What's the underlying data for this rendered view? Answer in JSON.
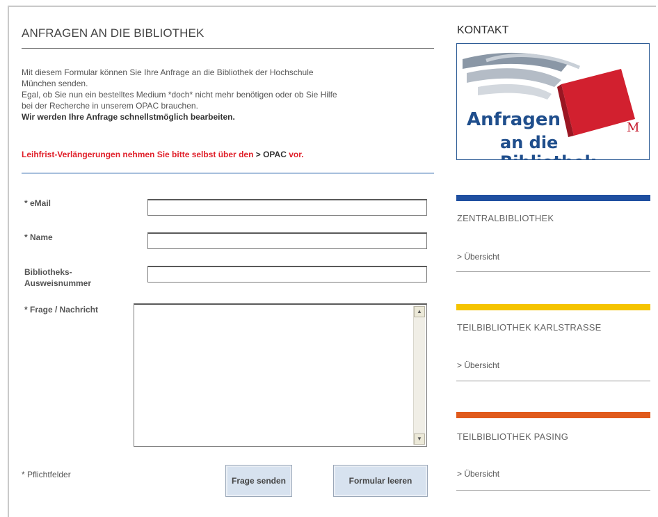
{
  "page": {
    "title": "ANFRAGEN AN DIE BIBLIOTHEK"
  },
  "intro": {
    "line1": "Mit diesem Formular können Sie Ihre Anfrage an die Bibliothek der Hochschule",
    "line2": "München senden.",
    "line3": "Egal, ob Sie nun ein bestelltes Medium *doch* nicht mehr benötigen oder ob Sie Hilfe",
    "line4": "bei der Recherche in unserem OPAC brauchen.",
    "bold": "Wir werden Ihre Anfrage schnellstmöglich bearbeiten."
  },
  "notice": {
    "text": "Leihfrist-Verlängerungen nehmen Sie bitte selbst über den",
    "link": "> OPAC",
    "suffix": "vor."
  },
  "form": {
    "email_label": "* eMail",
    "email_value": "",
    "name_label": "* Name",
    "name_value": "",
    "card_label_1": "Bibliotheks-",
    "card_label_2": "Ausweisnummer",
    "card_value": "",
    "message_label": "* Frage / Nachricht",
    "message_value": "",
    "required_note": "* Pflichtfelder",
    "submit_label": "Frage senden",
    "reset_label": "Formular leeren"
  },
  "sidebar": {
    "kontakt_heading": "KONTAKT",
    "logo_line1": "Anfragen",
    "logo_line2": "an die Bibliothek",
    "logo_mark": "M",
    "branches": [
      {
        "title": "ZENTRALBIBLIOTHEK",
        "link": "> Übersicht",
        "color": "#1f4fa0"
      },
      {
        "title": "TEILBIBLIOTHEK KARLSTRASSE",
        "link": "> Übersicht",
        "color": "#f5c400"
      },
      {
        "title": "TEILBIBLIOTHEK PASING",
        "link": "> Übersicht",
        "color": "#e05a1c"
      }
    ]
  },
  "icons": {
    "scroll_up": "scroll-up-arrow-icon",
    "scroll_down": "scroll-down-arrow-icon"
  }
}
